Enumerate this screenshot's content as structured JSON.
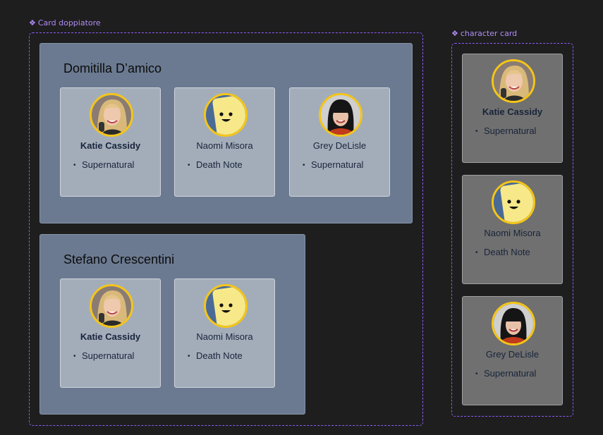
{
  "labels": {
    "card_doppiatore": "Card doppiatore",
    "character_card": "character card"
  },
  "doppiatori": [
    {
      "name": "Domitilla D’amico",
      "cards": [
        {
          "name": "Katie Cassidy",
          "series": "Supernatural",
          "avatar": "photo-blonde-woman"
        },
        {
          "name": "Naomi Misora",
          "series": "Death Note",
          "avatar": "smiley-placeholder"
        },
        {
          "name": "Grey DeLisle",
          "series": "Supernatural",
          "avatar": "photo-dark-hair-woman"
        }
      ]
    },
    {
      "name": "Stefano Crescentini",
      "cards": [
        {
          "name": "Katie Cassidy",
          "series": "Supernatural",
          "avatar": "photo-blonde-woman"
        },
        {
          "name": "Naomi Misora",
          "series": "Death Note",
          "avatar": "smiley-placeholder"
        }
      ]
    }
  ],
  "character_cards": [
    {
      "name": "Katie Cassidy",
      "series": "Supernatural",
      "avatar": "photo-blonde-woman"
    },
    {
      "name": "Naomi Misora",
      "series": "Death Note",
      "avatar": "smiley-placeholder"
    },
    {
      "name": "Grey DeLisle",
      "series": "Supernatural",
      "avatar": "photo-dark-hair-woman"
    }
  ],
  "colors": {
    "component_accent": "#8b5cf6",
    "avatar_border": "#f5c518",
    "doppiatore_bg": "#6b7a91",
    "card_light_bg": "#a3adba",
    "card_dark_bg": "#707070"
  }
}
